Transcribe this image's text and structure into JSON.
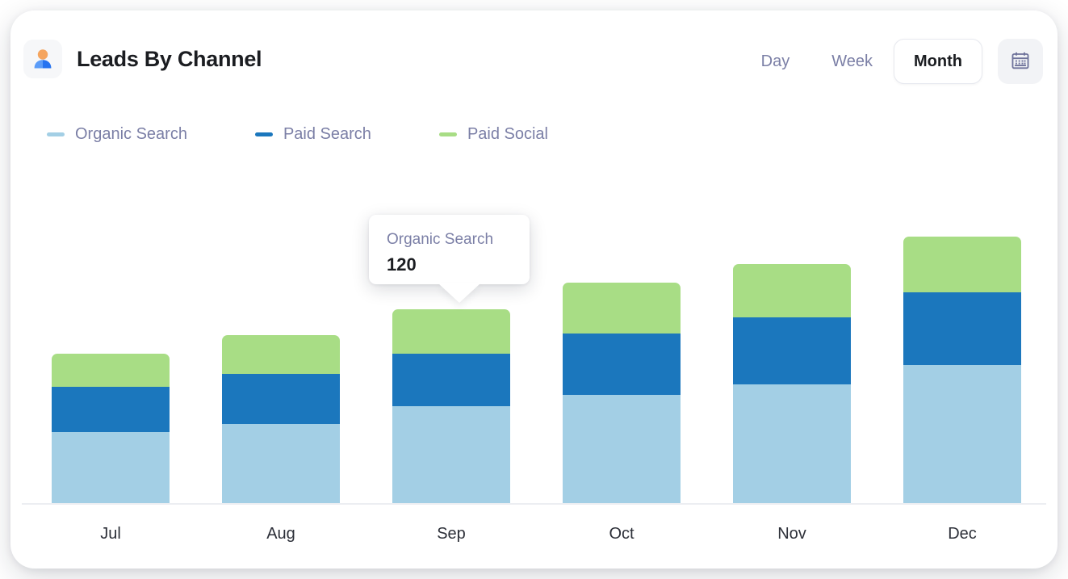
{
  "header": {
    "title": "Leads By Channel",
    "app_icon": "user-avatar-icon",
    "ranges": [
      {
        "label": "Day",
        "active": false
      },
      {
        "label": "Week",
        "active": false
      },
      {
        "label": "Month",
        "active": true
      }
    ],
    "calendar_icon": "calendar-icon"
  },
  "legend": {
    "items": [
      {
        "label": "Organic Search",
        "color": "#a3cfe5"
      },
      {
        "label": "Paid Search",
        "color": "#1b77bd"
      },
      {
        "label": "Paid Social",
        "color": "#a8dd85"
      }
    ]
  },
  "tooltip": {
    "title": "Organic Search",
    "value": "120"
  },
  "colors": {
    "organic_search": "#a3cfe5",
    "paid_search": "#1b77bd",
    "paid_social": "#a8dd85",
    "muted_text": "#7b7fa6",
    "dark_text": "#1b1d21",
    "axis": "#eceef2"
  },
  "chart_data": {
    "type": "bar",
    "title": "Leads By Channel",
    "stacked": true,
    "xlabel": "",
    "ylabel": "",
    "grid": false,
    "legend_position": "top-left",
    "categories": [
      "Jul",
      "Aug",
      "Sep",
      "Oct",
      "Nov",
      "Dec"
    ],
    "series": [
      {
        "name": "Organic Search",
        "color": "#a3cfe5",
        "values": [
          88,
          98,
          120,
          134,
          147,
          171
        ]
      },
      {
        "name": "Paid Search",
        "color": "#1b77bd",
        "values": [
          56,
          62,
          65,
          76,
          83,
          90
        ]
      },
      {
        "name": "Paid Social",
        "color": "#a8dd85",
        "values": [
          41,
          48,
          55,
          63,
          66,
          69
        ]
      }
    ],
    "totals": [
      185,
      208,
      240,
      273,
      296,
      330
    ],
    "ylim": [
      0,
      340
    ],
    "annotations": [
      {
        "category": "Sep",
        "series": "Organic Search",
        "value": 120,
        "type": "tooltip"
      }
    ]
  }
}
